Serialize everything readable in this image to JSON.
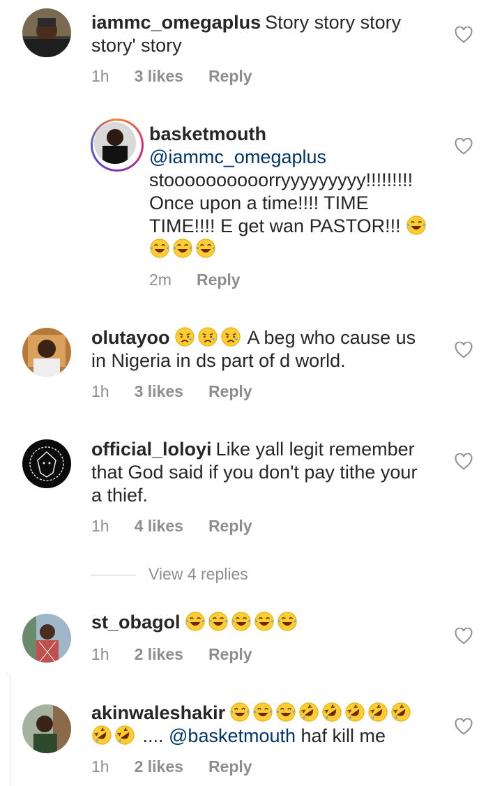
{
  "comments": [
    {
      "username": "iammc_omegaplus",
      "text_line1": "Story story story",
      "text_line2": "story' story",
      "time": "1h",
      "likes": "3 likes",
      "reply": "Reply"
    },
    {
      "username": "basketmouth",
      "mention": "@iammc_omegaplus",
      "line2": "stoooooooooorryyyyyyyyy!!!!!!!!!",
      "line3": "Once upon a time!!!! TIME",
      "line4": "TIME!!!! E get wan PASTOR!!!",
      "time": "2m",
      "reply": "Reply"
    },
    {
      "username": "olutayoo",
      "text_line1": "A beg who cause us",
      "text_line2": "in Nigeria in ds part of d world.",
      "time": "1h",
      "likes": "3 likes",
      "reply": "Reply"
    },
    {
      "username": "official_loloyi",
      "text_line1": "Like yall legit remember",
      "text_line2": "that God said if you don't pay tithe your",
      "text_line3": "a thief.",
      "time": "1h",
      "likes": "4 likes",
      "reply": "Reply",
      "view_replies": "View 4 replies"
    },
    {
      "username": "st_obagol",
      "time": "1h",
      "likes": "2 likes",
      "reply": "Reply"
    },
    {
      "username": "akinwaleshakir",
      "text_tail": " .... ",
      "mention": "@basketmouth",
      "text_end": " haf kill me",
      "time": "1h",
      "likes": "2 likes",
      "reply": "Reply"
    }
  ],
  "icons": {
    "heart": "heart-outline-icon",
    "joy": "face-with-tears-of-joy",
    "rofl": "rolling-on-floor-laughing",
    "cry": "crying-face"
  },
  "colors": {
    "text": "#262626",
    "meta": "#8e8e8e",
    "mention": "#003569"
  }
}
